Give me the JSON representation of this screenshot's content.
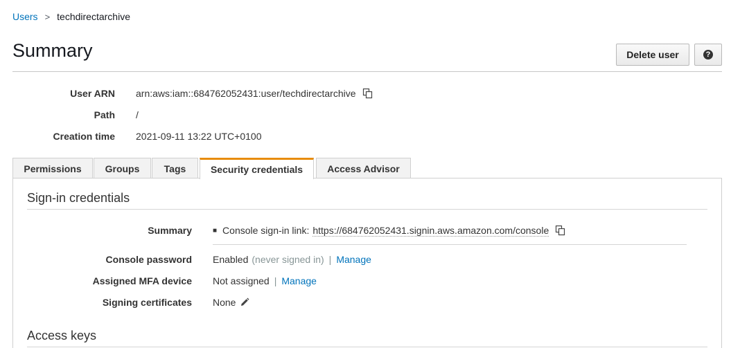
{
  "breadcrumb": {
    "parent": "Users",
    "separator": ">",
    "current": "techdirectarchive"
  },
  "header": {
    "title": "Summary",
    "delete_label": "Delete user",
    "help_symbol": "?"
  },
  "details": {
    "arn_label": "User ARN",
    "arn_value": "arn:aws:iam::684762052431:user/techdirectarchive",
    "path_label": "Path",
    "path_value": "/",
    "creation_label": "Creation time",
    "creation_value": "2021-09-11 13:22 UTC+0100"
  },
  "tabs": [
    {
      "label": "Permissions",
      "active": false
    },
    {
      "label": "Groups",
      "active": false
    },
    {
      "label": "Tags",
      "active": false
    },
    {
      "label": "Security credentials",
      "active": true
    },
    {
      "label": "Access Advisor",
      "active": false
    }
  ],
  "signin": {
    "title": "Sign-in credentials",
    "summary_label": "Summary",
    "summary_prefix": "Console sign-in link:",
    "summary_link": "https://684762052431.signin.aws.amazon.com/console",
    "password_label": "Console password",
    "password_status": "Enabled",
    "password_note": "(never signed in)",
    "password_action": "Manage",
    "mfa_label": "Assigned MFA device",
    "mfa_value": "Not assigned",
    "mfa_action": "Manage",
    "certs_label": "Signing certificates",
    "certs_value": "None"
  },
  "access_keys": {
    "title": "Access keys"
  },
  "colors": {
    "link": "#0073bb",
    "active_tab_accent": "#e88c0c",
    "muted": "#879596"
  }
}
